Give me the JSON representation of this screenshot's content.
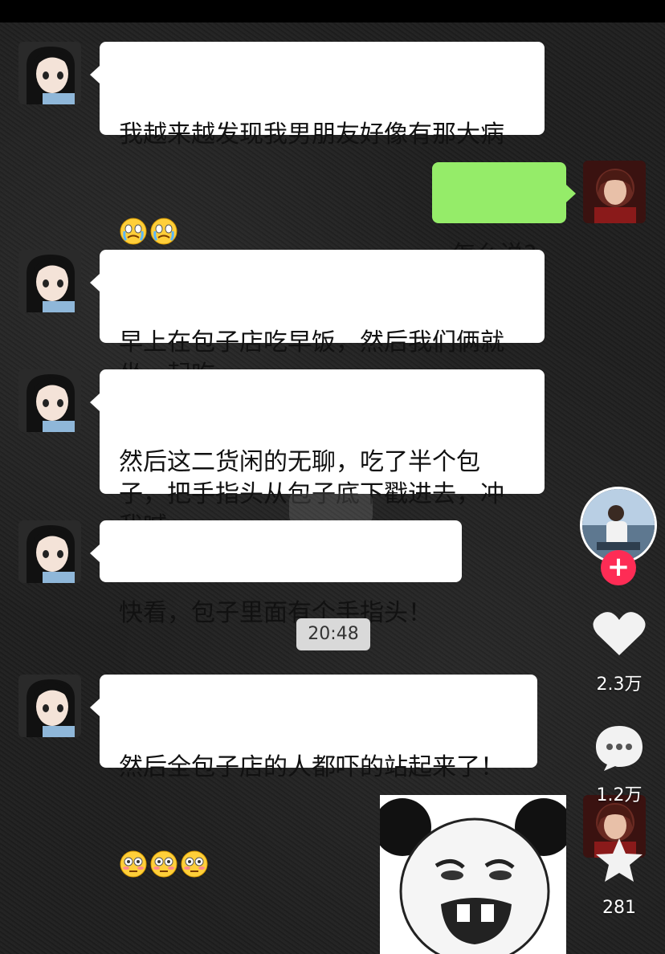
{
  "chat": {
    "messages": [
      {
        "side": "left",
        "text": "我越来越发现我男朋友好像有那大病",
        "emojis": [
          "crying-face",
          "crying-face"
        ]
      },
      {
        "side": "right",
        "text": "怎么说?"
      },
      {
        "side": "left",
        "text": "早上在包子店吃早饭，然后我们俩就\n坐一起吃"
      },
      {
        "side": "left",
        "text": "然后这二货闲的无聊，吃了半个包\n子，把手指头从包子底下戳进去，冲\n我喊"
      },
      {
        "side": "left",
        "text": "快看，包子里面有个手指头！"
      },
      {
        "side": "left",
        "text": "然后全包子店的人都吓的站起来了！",
        "emojis": [
          "flushed-face",
          "flushed-face",
          "flushed-face"
        ]
      }
    ],
    "timestamp": "20:48",
    "sticker": "panda-meme-face",
    "colors": {
      "received_bubble": "#ffffff",
      "sent_bubble": "#95ec69",
      "background": "#202020"
    }
  },
  "sidebar": {
    "follow_label": "+",
    "like_count": "2.3万",
    "comment_count": "1.2万",
    "favorite_count": "281",
    "icons": [
      "creator-avatar",
      "heart-icon",
      "comment-icon",
      "star-icon"
    ]
  }
}
